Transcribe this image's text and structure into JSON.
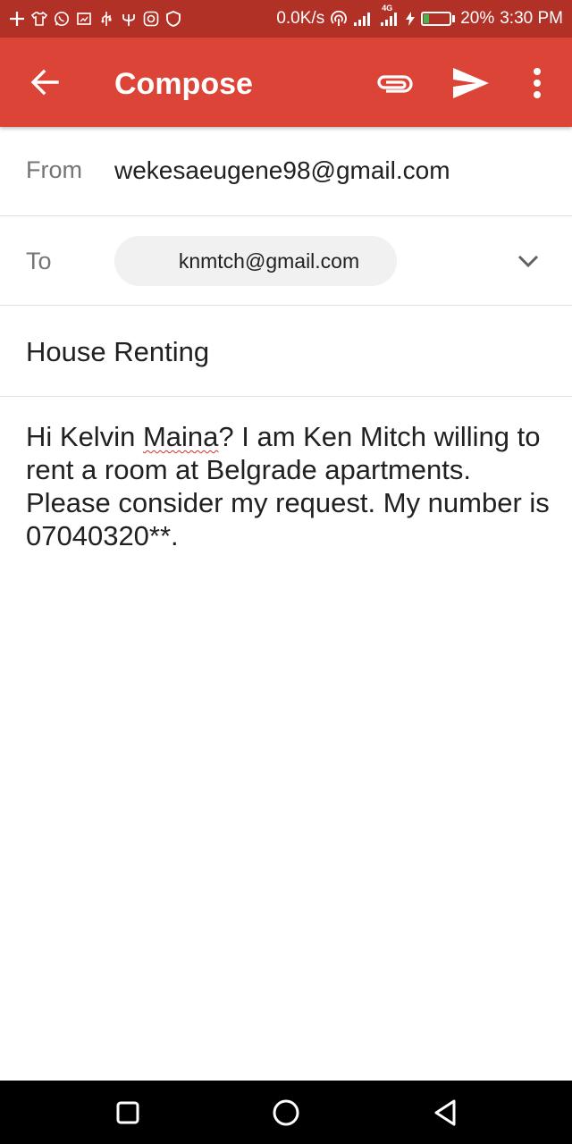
{
  "status_bar": {
    "network_speed": "0.0K/s",
    "network_type": "4G",
    "battery": "20%",
    "time": "3:30 PM",
    "icons": [
      "plus-icon",
      "shirt-icon",
      "whatsapp-icon",
      "cast-icon",
      "usb-icon",
      "trident-icon",
      "instagram-icon",
      "shield-icon",
      "hotspot-icon",
      "signal-icon",
      "charging-icon",
      "battery-icon"
    ]
  },
  "appbar": {
    "title": "Compose",
    "color": "#db4437"
  },
  "from": {
    "label": "From",
    "value": "wekesaeugene98@gmail.com"
  },
  "to": {
    "label": "To",
    "recipient": "knmtch@gmail.com"
  },
  "subject": "House Renting",
  "body": {
    "before": "Hi Kelvin ",
    "misspelled": "Maina",
    "after": "? I am Ken Mitch willing to rent a room at Belgrade apartments. Please consider my request. My number is 07040320**."
  }
}
